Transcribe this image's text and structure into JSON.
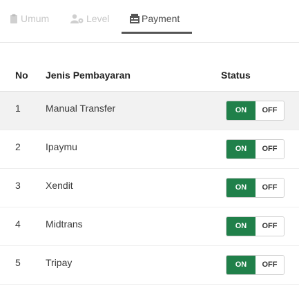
{
  "tabs": [
    {
      "label": "Umum",
      "icon": "clipboard-icon",
      "active": false
    },
    {
      "label": "Level",
      "icon": "users-cog-icon",
      "active": false
    },
    {
      "label": "Payment",
      "icon": "money-icon",
      "active": true
    }
  ],
  "table": {
    "headers": {
      "no": "No",
      "name": "Jenis Pembayaran",
      "status": "Status"
    },
    "rows": [
      {
        "no": "1",
        "name": "Manual Transfer",
        "on": "ON",
        "off": "OFF"
      },
      {
        "no": "2",
        "name": "Ipaymu",
        "on": "ON",
        "off": "OFF"
      },
      {
        "no": "3",
        "name": "Xendit",
        "on": "ON",
        "off": "OFF"
      },
      {
        "no": "4",
        "name": "Midtrans",
        "on": "ON",
        "off": "OFF"
      },
      {
        "no": "5",
        "name": "Tripay",
        "on": "ON",
        "off": "OFF"
      }
    ]
  },
  "colors": {
    "toggle_on": "#20804a",
    "tab_active_underline": "#555555"
  }
}
